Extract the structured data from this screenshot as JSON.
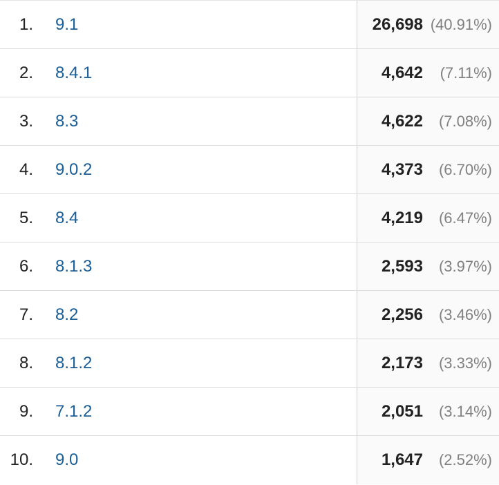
{
  "rows": [
    {
      "rank": "1.",
      "version": "9.1",
      "count": "26,698",
      "percent": "(40.91%)"
    },
    {
      "rank": "2.",
      "version": "8.4.1",
      "count": "4,642",
      "percent": "(7.11%)"
    },
    {
      "rank": "3.",
      "version": "8.3",
      "count": "4,622",
      "percent": "(7.08%)"
    },
    {
      "rank": "4.",
      "version": "9.0.2",
      "count": "4,373",
      "percent": "(6.70%)"
    },
    {
      "rank": "5.",
      "version": "8.4",
      "count": "4,219",
      "percent": "(6.47%)"
    },
    {
      "rank": "6.",
      "version": "8.1.3",
      "count": "2,593",
      "percent": "(3.97%)"
    },
    {
      "rank": "7.",
      "version": "8.2",
      "count": "2,256",
      "percent": "(3.46%)"
    },
    {
      "rank": "8.",
      "version": "8.1.2",
      "count": "2,173",
      "percent": "(3.33%)"
    },
    {
      "rank": "9.",
      "version": "7.1.2",
      "count": "2,051",
      "percent": "(3.14%)"
    },
    {
      "rank": "10.",
      "version": "9.0",
      "count": "1,647",
      "percent": "(2.52%)"
    }
  ],
  "colors": {
    "link": "#1a5e98",
    "text": "#222222",
    "muted": "#808080",
    "divider": "#dcdcdc"
  }
}
